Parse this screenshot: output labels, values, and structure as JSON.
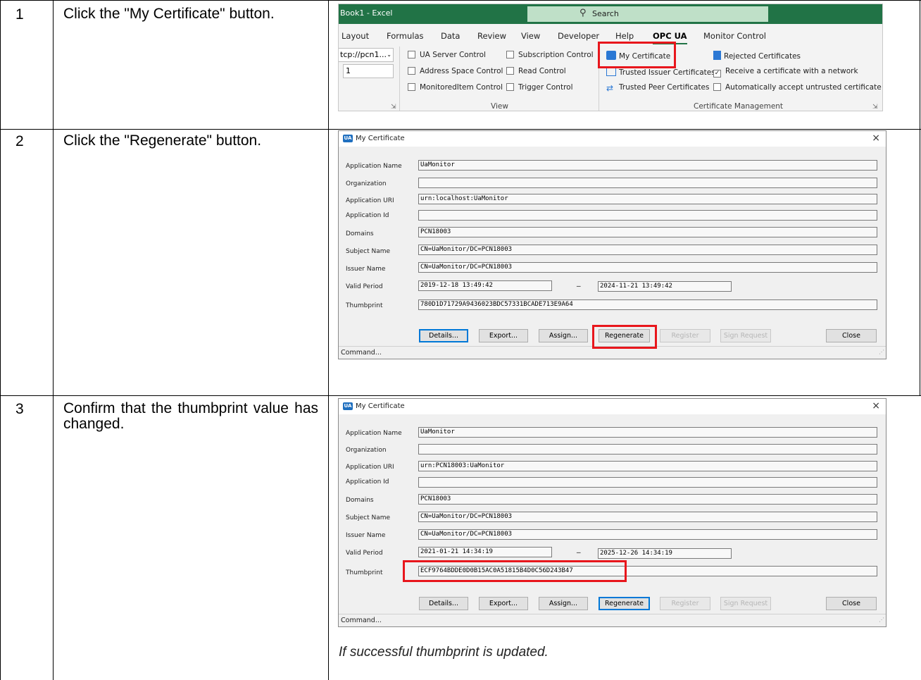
{
  "steps": [
    {
      "num": "1",
      "text": "Click the \"My Certificate\" button."
    },
    {
      "num": "2",
      "text": "Click the \"Regenerate\" button."
    },
    {
      "num": "3",
      "text": "Confirm that the thumbprint value has changed."
    }
  ],
  "ribbon": {
    "title": "Book1 - Excel",
    "search": "Search",
    "tabs": [
      "Layout",
      "Formulas",
      "Data",
      "Review",
      "View",
      "Developer",
      "Help",
      "OPC UA",
      "Monitor Control"
    ],
    "active_tab": "OPC UA",
    "server_dropdown": "tcp://pcn1...",
    "server_index": "1",
    "view_items": [
      "UA Server Control",
      "Subscription Control",
      "Address Space Control",
      "Read Control",
      "MonitoredItem Control",
      "Trigger Control"
    ],
    "view_group": "View",
    "cert_items": {
      "my_certificate": "My Certificate",
      "rejected": "Rejected Certificates",
      "trusted_issuer": "Trusted Issuer Certificates",
      "receive_network": "Receive a certificate with a network",
      "trusted_peer": "Trusted Peer Certificates",
      "auto_accept": "Automatically accept untrusted certificate"
    },
    "receive_network_checked": true,
    "cert_group": "Certificate Management"
  },
  "dialog_labels": {
    "title": "My Certificate",
    "application_name": "Application Name",
    "organization": "Organization",
    "application_uri": "Application URI",
    "application_id": "Application Id",
    "domains": "Domains",
    "subject_name": "Subject Name",
    "issuer_name": "Issuer Name",
    "valid_period": "Valid Period",
    "thumbprint": "Thumbprint",
    "period_separator": "_",
    "buttons": {
      "details": "Details...",
      "export": "Export...",
      "assign": "Assign...",
      "regenerate": "Regenerate",
      "register": "Register",
      "sign_request": "Sign Request",
      "close": "Close"
    },
    "status": "Command..."
  },
  "dialog_before": {
    "application_name": "UaMonitor",
    "organization": "",
    "application_uri": "urn:localhost:UaMonitor",
    "application_id": "",
    "domains": "PCN18003",
    "subject_name": "CN=UaMonitor/DC=PCN18003",
    "issuer_name": "CN=UaMonitor/DC=PCN18003",
    "valid_from": "2019-12-18 13:49:42",
    "valid_to": "2024-11-21 13:49:42",
    "thumbprint": "780D1D71729A9436023BDC57331BCADE713E9A64"
  },
  "dialog_after": {
    "application_name": "UaMonitor",
    "organization": "",
    "application_uri": "urn:PCN18003:UaMonitor",
    "application_id": "",
    "domains": "PCN18003",
    "subject_name": "CN=UaMonitor/DC=PCN18003",
    "issuer_name": "CN=UaMonitor/DC=PCN18003",
    "valid_from": "2021-01-21 14:34:19",
    "valid_to": "2025-12-26 14:34:19",
    "thumbprint": "ECF9764BDDE0D0B15AC0A51815B4D0C56D243B47"
  },
  "footnote": "If successful thumbprint is updated.",
  "colors": {
    "highlight": "#e8161c",
    "excel_green": "#217346"
  }
}
